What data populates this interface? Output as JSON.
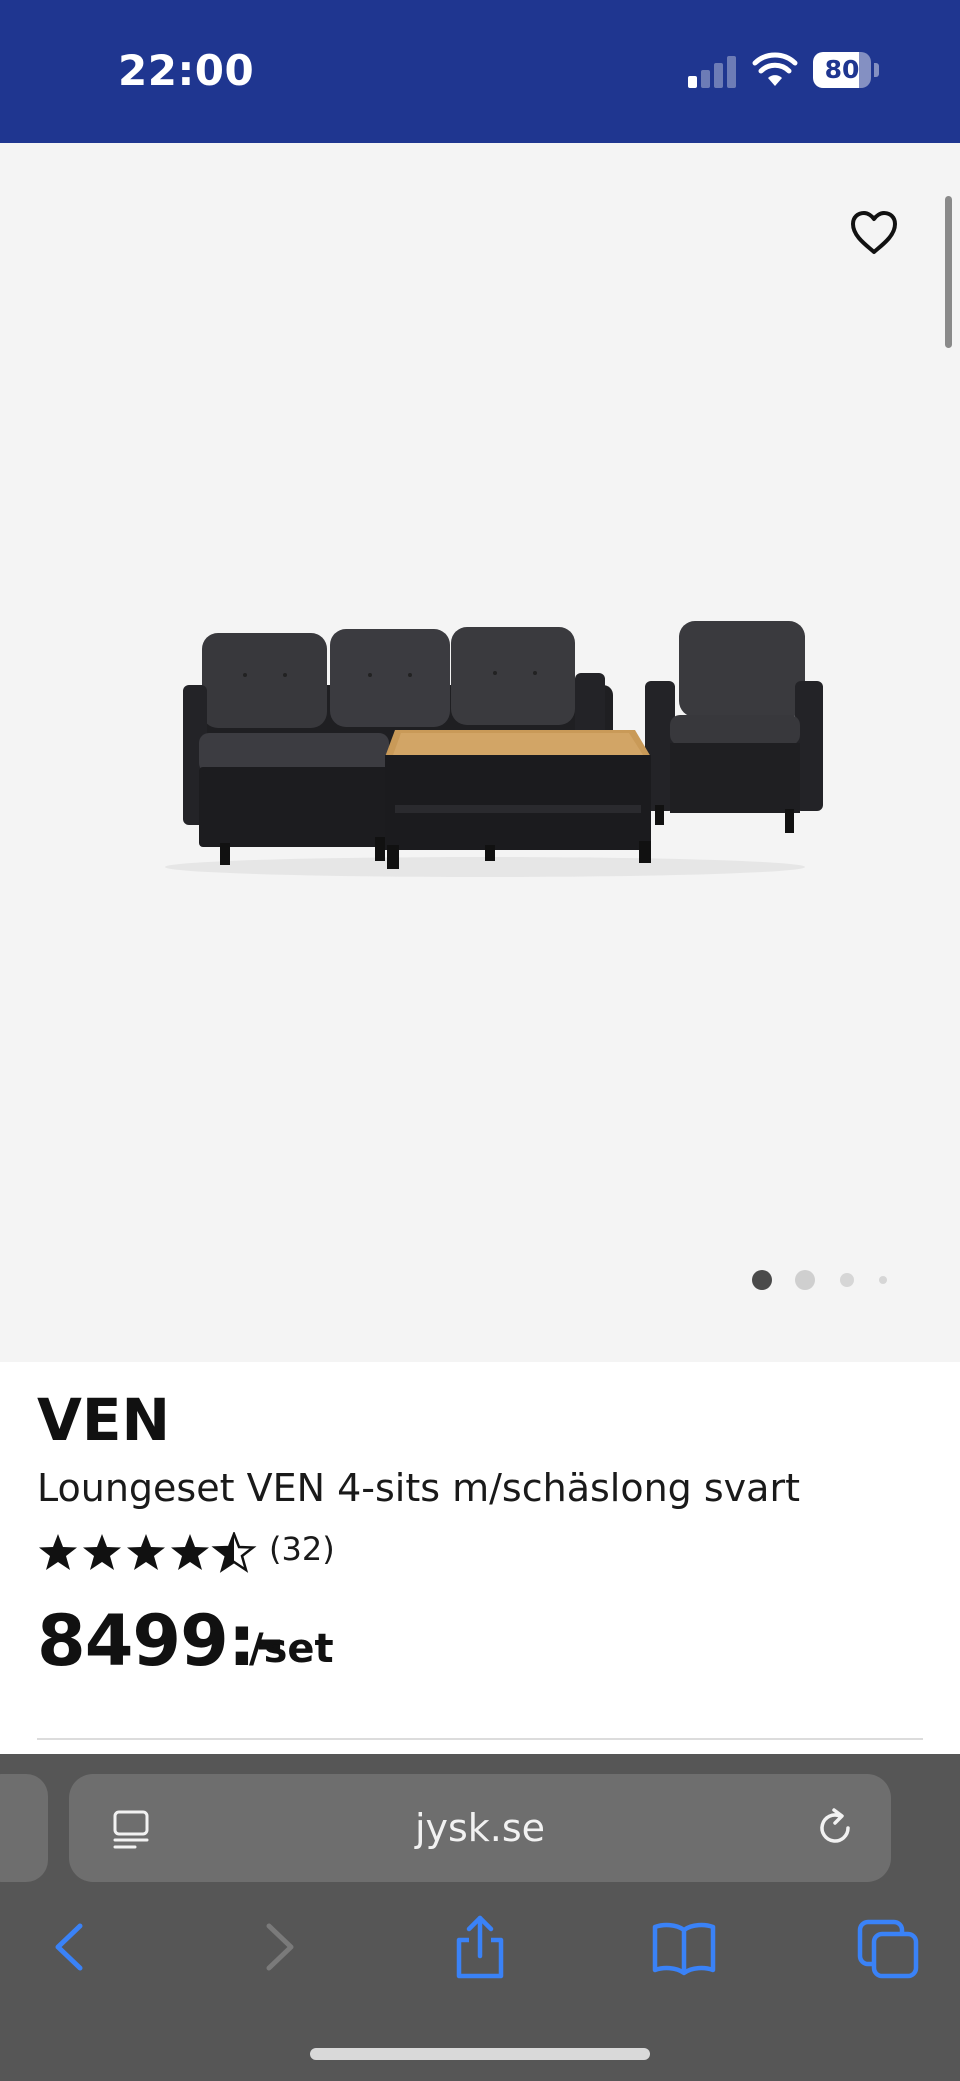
{
  "status_bar": {
    "time": "22:00",
    "battery_level": "80",
    "signal_bars_active": 1,
    "signal_bars_total": 4,
    "background_color": "#1f3690"
  },
  "gallery": {
    "favorite_icon": "heart-outline-icon",
    "image_count": 4,
    "active_image": 1,
    "background_color": "#f4f4f4"
  },
  "product": {
    "brand": "VEN",
    "name": "Loungeset VEN 4-sits m/schäslong svart",
    "rating_stars": 4.5,
    "rating_count": "(32)",
    "price": "8499:-",
    "price_unit": "/set"
  },
  "browser": {
    "url": "jysk.se",
    "reader_icon": "page-menu-icon",
    "reload_icon": "reload-icon",
    "toolbar": [
      "back-icon",
      "forward-icon",
      "share-icon",
      "bookmarks-icon",
      "tabs-icon"
    ],
    "accent_color": "#3a82f7"
  }
}
